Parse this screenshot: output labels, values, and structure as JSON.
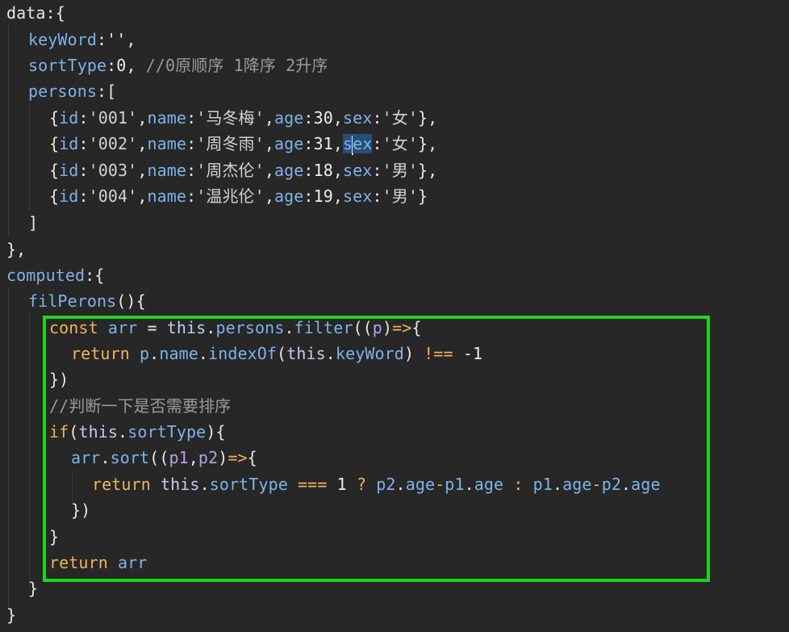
{
  "editor": {
    "accent_color": "#1fd31f",
    "lines": [
      "data:{",
      "  keyWord:'',",
      "  sortType:0, //0原顺序 1降序 2升序",
      "  persons:[",
      "    {id:'001',name:'马冬梅',age:30,sex:'女'},",
      "    {id:'002',name:'周冬雨',age:31,sex:'女'},",
      "    {id:'003',name:'周杰伦',age:18,sex:'男'},",
      "    {id:'004',name:'温兆伦',age:19,sex:'男'}",
      "  ]",
      "},",
      "computed:{",
      "  filPerons(){",
      "    const arr = this.persons.filter((p)=>{",
      "      return p.name.indexOf(this.keyWord) !== -1",
      "    })",
      "    //判断一下是否需要排序",
      "    if(this.sortType){",
      "      arr.sort((p1,p2)=>{",
      "        return this.sortType === 1 ? p2.age-p1.age : p1.age-p2.age",
      "      })",
      "    }",
      "    return arr",
      "  }",
      "}"
    ]
  }
}
